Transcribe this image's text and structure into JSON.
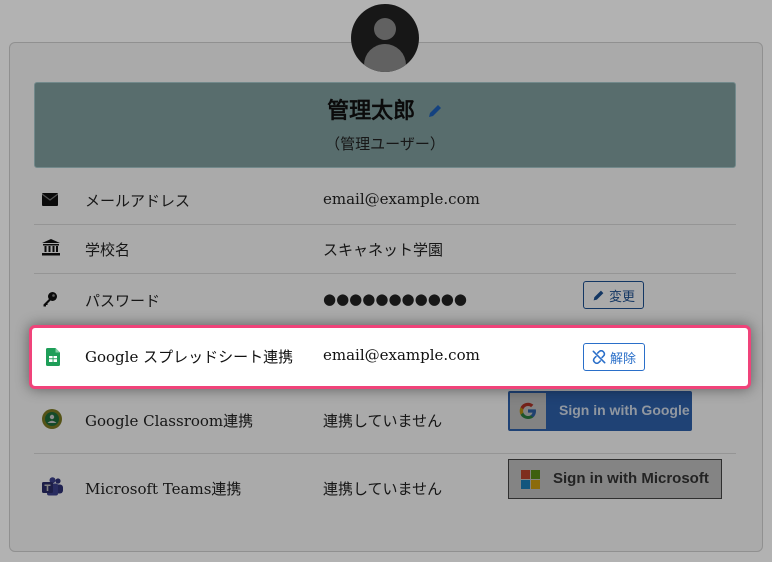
{
  "profile": {
    "name": "管理太郎",
    "role": "（管理ユーザー）"
  },
  "rows": {
    "email": {
      "label": "メールアドレス",
      "value": "email@example.com"
    },
    "school": {
      "label": "学校名",
      "value": "スキャネット学園"
    },
    "password": {
      "label": "パスワード",
      "value": "●●●●●●●●●●●",
      "button": "変更"
    },
    "sheets": {
      "label": "Google スプレッドシート連携",
      "value": "email@example.com",
      "button": "解除"
    },
    "classroom": {
      "label": "Google Classroom連携",
      "value": "連携していません",
      "button": "Sign in with Google"
    },
    "teams": {
      "label": "Microsoft Teams連携",
      "value": "連携していません",
      "button": "Sign in with Microsoft"
    }
  },
  "icons": [
    "user-avatar-icon",
    "pencil-icon",
    "envelope-icon",
    "school-icon",
    "key-icon",
    "google-sheets-icon",
    "unlink-icon",
    "google-classroom-icon",
    "google-g-icon",
    "microsoft-teams-icon",
    "microsoft-logo-icon"
  ],
  "colors": {
    "accent": "#2a6fc9",
    "highlight": "#f0437a",
    "header_bg": "#a4c5c7"
  }
}
